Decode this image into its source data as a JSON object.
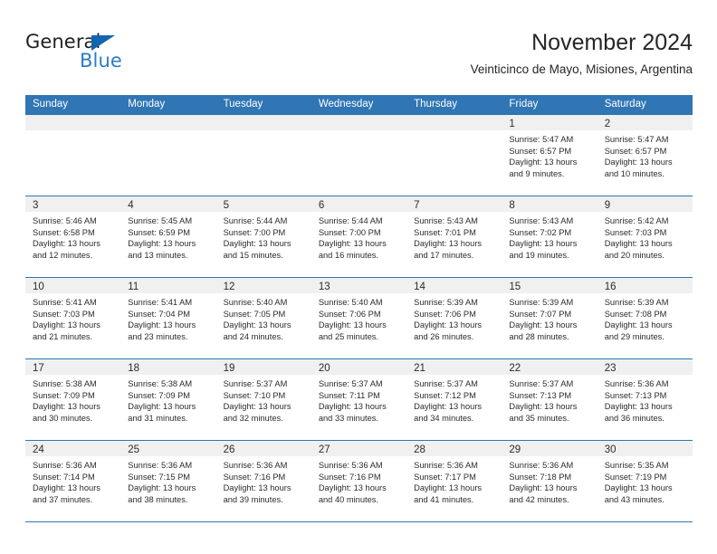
{
  "brand": {
    "name_part1": "General",
    "name_part2": "Blue",
    "triangle_color": "#1266ad",
    "blue_color": "#2e7cc4"
  },
  "header": {
    "title": "November 2024",
    "subtitle": "Veinticinco de Mayo, Misiones, Argentina",
    "accent_color": "#3075b4"
  },
  "calendar": {
    "weekday_headers": [
      "Sunday",
      "Monday",
      "Tuesday",
      "Wednesday",
      "Thursday",
      "Friday",
      "Saturday"
    ],
    "weeks": [
      [
        {
          "day": "",
          "sunrise": "",
          "sunset": "",
          "daylight": ""
        },
        {
          "day": "",
          "sunrise": "",
          "sunset": "",
          "daylight": ""
        },
        {
          "day": "",
          "sunrise": "",
          "sunset": "",
          "daylight": ""
        },
        {
          "day": "",
          "sunrise": "",
          "sunset": "",
          "daylight": ""
        },
        {
          "day": "",
          "sunrise": "",
          "sunset": "",
          "daylight": ""
        },
        {
          "day": "1",
          "sunrise": "Sunrise: 5:47 AM",
          "sunset": "Sunset: 6:57 PM",
          "daylight": "Daylight: 13 hours and 9 minutes."
        },
        {
          "day": "2",
          "sunrise": "Sunrise: 5:47 AM",
          "sunset": "Sunset: 6:57 PM",
          "daylight": "Daylight: 13 hours and 10 minutes."
        }
      ],
      [
        {
          "day": "3",
          "sunrise": "Sunrise: 5:46 AM",
          "sunset": "Sunset: 6:58 PM",
          "daylight": "Daylight: 13 hours and 12 minutes."
        },
        {
          "day": "4",
          "sunrise": "Sunrise: 5:45 AM",
          "sunset": "Sunset: 6:59 PM",
          "daylight": "Daylight: 13 hours and 13 minutes."
        },
        {
          "day": "5",
          "sunrise": "Sunrise: 5:44 AM",
          "sunset": "Sunset: 7:00 PM",
          "daylight": "Daylight: 13 hours and 15 minutes."
        },
        {
          "day": "6",
          "sunrise": "Sunrise: 5:44 AM",
          "sunset": "Sunset: 7:00 PM",
          "daylight": "Daylight: 13 hours and 16 minutes."
        },
        {
          "day": "7",
          "sunrise": "Sunrise: 5:43 AM",
          "sunset": "Sunset: 7:01 PM",
          "daylight": "Daylight: 13 hours and 17 minutes."
        },
        {
          "day": "8",
          "sunrise": "Sunrise: 5:43 AM",
          "sunset": "Sunset: 7:02 PM",
          "daylight": "Daylight: 13 hours and 19 minutes."
        },
        {
          "day": "9",
          "sunrise": "Sunrise: 5:42 AM",
          "sunset": "Sunset: 7:03 PM",
          "daylight": "Daylight: 13 hours and 20 minutes."
        }
      ],
      [
        {
          "day": "10",
          "sunrise": "Sunrise: 5:41 AM",
          "sunset": "Sunset: 7:03 PM",
          "daylight": "Daylight: 13 hours and 21 minutes."
        },
        {
          "day": "11",
          "sunrise": "Sunrise: 5:41 AM",
          "sunset": "Sunset: 7:04 PM",
          "daylight": "Daylight: 13 hours and 23 minutes."
        },
        {
          "day": "12",
          "sunrise": "Sunrise: 5:40 AM",
          "sunset": "Sunset: 7:05 PM",
          "daylight": "Daylight: 13 hours and 24 minutes."
        },
        {
          "day": "13",
          "sunrise": "Sunrise: 5:40 AM",
          "sunset": "Sunset: 7:06 PM",
          "daylight": "Daylight: 13 hours and 25 minutes."
        },
        {
          "day": "14",
          "sunrise": "Sunrise: 5:39 AM",
          "sunset": "Sunset: 7:06 PM",
          "daylight": "Daylight: 13 hours and 26 minutes."
        },
        {
          "day": "15",
          "sunrise": "Sunrise: 5:39 AM",
          "sunset": "Sunset: 7:07 PM",
          "daylight": "Daylight: 13 hours and 28 minutes."
        },
        {
          "day": "16",
          "sunrise": "Sunrise: 5:39 AM",
          "sunset": "Sunset: 7:08 PM",
          "daylight": "Daylight: 13 hours and 29 minutes."
        }
      ],
      [
        {
          "day": "17",
          "sunrise": "Sunrise: 5:38 AM",
          "sunset": "Sunset: 7:09 PM",
          "daylight": "Daylight: 13 hours and 30 minutes."
        },
        {
          "day": "18",
          "sunrise": "Sunrise: 5:38 AM",
          "sunset": "Sunset: 7:09 PM",
          "daylight": "Daylight: 13 hours and 31 minutes."
        },
        {
          "day": "19",
          "sunrise": "Sunrise: 5:37 AM",
          "sunset": "Sunset: 7:10 PM",
          "daylight": "Daylight: 13 hours and 32 minutes."
        },
        {
          "day": "20",
          "sunrise": "Sunrise: 5:37 AM",
          "sunset": "Sunset: 7:11 PM",
          "daylight": "Daylight: 13 hours and 33 minutes."
        },
        {
          "day": "21",
          "sunrise": "Sunrise: 5:37 AM",
          "sunset": "Sunset: 7:12 PM",
          "daylight": "Daylight: 13 hours and 34 minutes."
        },
        {
          "day": "22",
          "sunrise": "Sunrise: 5:37 AM",
          "sunset": "Sunset: 7:13 PM",
          "daylight": "Daylight: 13 hours and 35 minutes."
        },
        {
          "day": "23",
          "sunrise": "Sunrise: 5:36 AM",
          "sunset": "Sunset: 7:13 PM",
          "daylight": "Daylight: 13 hours and 36 minutes."
        }
      ],
      [
        {
          "day": "24",
          "sunrise": "Sunrise: 5:36 AM",
          "sunset": "Sunset: 7:14 PM",
          "daylight": "Daylight: 13 hours and 37 minutes."
        },
        {
          "day": "25",
          "sunrise": "Sunrise: 5:36 AM",
          "sunset": "Sunset: 7:15 PM",
          "daylight": "Daylight: 13 hours and 38 minutes."
        },
        {
          "day": "26",
          "sunrise": "Sunrise: 5:36 AM",
          "sunset": "Sunset: 7:16 PM",
          "daylight": "Daylight: 13 hours and 39 minutes."
        },
        {
          "day": "27",
          "sunrise": "Sunrise: 5:36 AM",
          "sunset": "Sunset: 7:16 PM",
          "daylight": "Daylight: 13 hours and 40 minutes."
        },
        {
          "day": "28",
          "sunrise": "Sunrise: 5:36 AM",
          "sunset": "Sunset: 7:17 PM",
          "daylight": "Daylight: 13 hours and 41 minutes."
        },
        {
          "day": "29",
          "sunrise": "Sunrise: 5:36 AM",
          "sunset": "Sunset: 7:18 PM",
          "daylight": "Daylight: 13 hours and 42 minutes."
        },
        {
          "day": "30",
          "sunrise": "Sunrise: 5:35 AM",
          "sunset": "Sunset: 7:19 PM",
          "daylight": "Daylight: 13 hours and 43 minutes."
        }
      ]
    ]
  }
}
